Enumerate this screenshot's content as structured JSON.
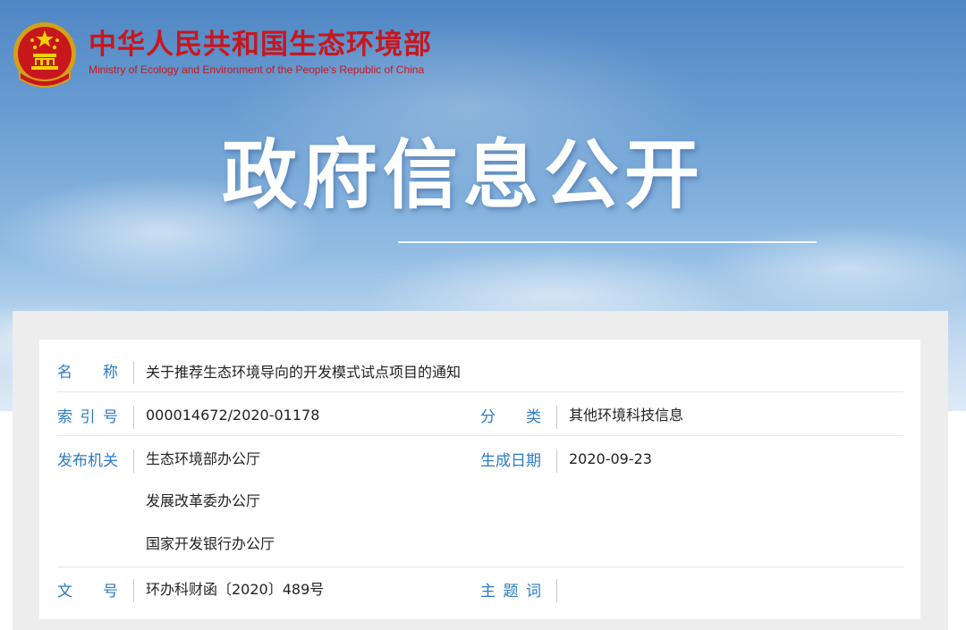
{
  "header": {
    "ministry_cn": "中华人民共和国生态环境部",
    "ministry_en": "Ministry of Ecology and Environment of the People's Republic of China",
    "section_title": "政府信息公开"
  },
  "colors": {
    "brand_red": "#c8161d",
    "label_blue": "#2b7bc3",
    "value_text": "#222222"
  },
  "icons": {
    "emblem": "national-emblem-icon"
  },
  "info": {
    "name_label": [
      "名",
      "称"
    ],
    "name_value": "关于推荐生态环境导向的开发模式试点项目的通知",
    "index_label": [
      "索",
      "引",
      "号"
    ],
    "index_value": "000014672/2020-01178",
    "category_label": [
      "分",
      "类"
    ],
    "category_value": "其他环境科技信息",
    "issuer_label": "发布机关",
    "issuers": [
      "生态环境部办公厅",
      "发展改革委办公厅",
      "国家开发银行办公厅"
    ],
    "date_label": "生成日期",
    "date_value": "2020-09-23",
    "docno_label": [
      "文",
      "号"
    ],
    "docno_value": "环办科财函〔2020〕489号",
    "keywords_label": [
      "主",
      "题",
      "词"
    ],
    "keywords_value": ""
  }
}
